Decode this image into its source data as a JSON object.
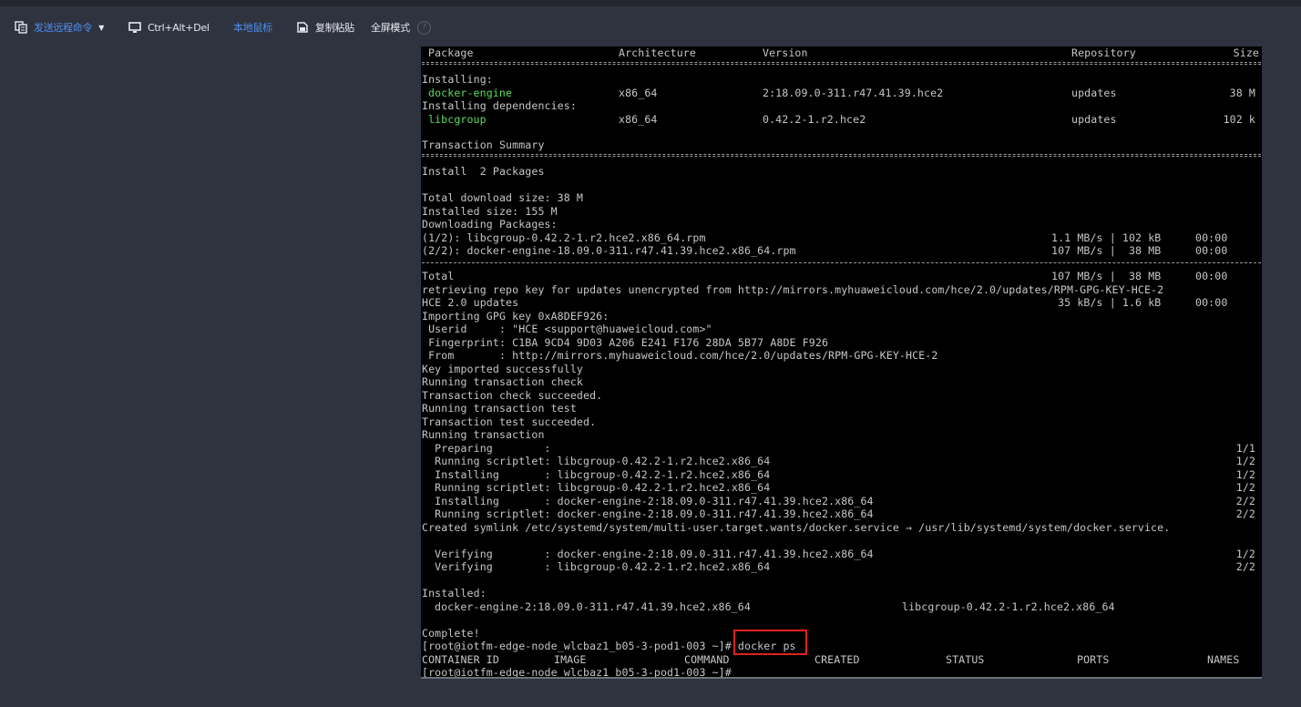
{
  "toolbar": {
    "send_remote_cmd": "发送远程命令",
    "ctrl_alt_del": "Ctrl+Alt+Del",
    "local_mouse": "本地鼠标",
    "copy_paste": "复制粘贴",
    "fullscreen": "全屏模式",
    "help": "?"
  },
  "table_header": {
    "package": "Package",
    "architecture": "Architecture",
    "version": "Version",
    "repository": "Repository",
    "size": "Size"
  },
  "installing_label": "Installing:",
  "installing_deps_label": "Installing dependencies:",
  "packages": [
    {
      "name": "docker-engine",
      "arch": "x86_64",
      "version": "2:18.09.0-311.r47.41.39.hce2",
      "repo": "updates",
      "size": "38 M"
    },
    {
      "name": "libcgroup",
      "arch": "x86_64",
      "version": "0.42.2-1.r2.hce2",
      "repo": "updates",
      "size": "102 k"
    }
  ],
  "transaction_summary": "Transaction Summary",
  "install_count": "Install  2 Packages",
  "total_download": "Total download size: 38 M",
  "installed_size": "Installed size: 155 M",
  "downloading": "Downloading Packages:",
  "downloads": [
    {
      "name": "(1/2): libcgroup-0.42.2-1.r2.hce2.x86_64.rpm",
      "speed": "1.1 MB/s | 102 kB",
      "time": "00:00"
    },
    {
      "name": "(2/2): docker-engine-18.09.0-311.r47.41.39.hce2.x86_64.rpm",
      "speed": "107 MB/s |  38 MB",
      "time": "00:00"
    }
  ],
  "total_line": {
    "label": "Total",
    "speed": "107 MB/s |  38 MB",
    "time": "00:00"
  },
  "repo_key_line": "retrieving repo key for updates unencrypted from http://mirrors.myhuaweicloud.com/hce/2.0/updates/RPM-GPG-KEY-HCE-2",
  "hce_updates": {
    "label": "HCE 2.0 updates",
    "speed": " 35 kB/s | 1.6 kB",
    "time": "00:00"
  },
  "gpg_lines": [
    "Importing GPG key 0xA8DEF926:",
    " Userid     : \"HCE <support@huaweicloud.com>\"",
    " Fingerprint: C1BA 9CD4 9D03 A206 E241 F176 28DA 5B77 A8DE F926",
    " From       : http://mirrors.myhuaweicloud.com/hce/2.0/updates/RPM-GPG-KEY-HCE-2",
    "Key imported successfully",
    "Running transaction check",
    "Transaction check succeeded.",
    "Running transaction test",
    "Transaction test succeeded.",
    "Running transaction"
  ],
  "steps": [
    {
      "text": "  Preparing        :",
      "count": "1/1"
    },
    {
      "text": "  Running scriptlet: libcgroup-0.42.2-1.r2.hce2.x86_64",
      "count": "1/2"
    },
    {
      "text": "  Installing       : libcgroup-0.42.2-1.r2.hce2.x86_64",
      "count": "1/2"
    },
    {
      "text": "  Running scriptlet: libcgroup-0.42.2-1.r2.hce2.x86_64",
      "count": "1/2"
    },
    {
      "text": "  Installing       : docker-engine-2:18.09.0-311.r47.41.39.hce2.x86_64",
      "count": "2/2"
    },
    {
      "text": "  Running scriptlet: docker-engine-2:18.09.0-311.r47.41.39.hce2.x86_64",
      "count": "2/2"
    }
  ],
  "symlink_line": "Created symlink /etc/systemd/system/multi-user.target.wants/docker.service → /usr/lib/systemd/system/docker.service.",
  "verify": [
    {
      "text": "  Verifying        : docker-engine-2:18.09.0-311.r47.41.39.hce2.x86_64",
      "count": "1/2"
    },
    {
      "text": "  Verifying        : libcgroup-0.42.2-1.r2.hce2.x86_64",
      "count": "2/2"
    }
  ],
  "installed_label": "Installed:",
  "installed_items": [
    "docker-engine-2:18.09.0-311.r47.41.39.hce2.x86_64",
    "libcgroup-0.42.2-1.r2.hce2.x86_64"
  ],
  "complete": "Complete!",
  "prompt": "[root@iotfm-edge-node_wlcbaz1_b05-3-pod1-003 ~]# ",
  "command": "docker ps",
  "ps_header": {
    "container_id": "CONTAINER ID",
    "image": "IMAGE",
    "command": "COMMAND",
    "created": "CREATED",
    "status": "STATUS",
    "ports": "PORTS",
    "names": "NAMES"
  },
  "final_prompt": "[root@iotfm-edge-node_wlcbaz1_b05-3-pod1-003 ~]#"
}
